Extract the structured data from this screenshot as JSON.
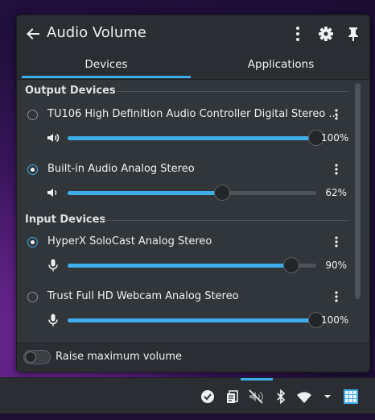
{
  "header": {
    "title": "Audio Volume"
  },
  "tabs": [
    {
      "label": "Devices",
      "active": true
    },
    {
      "label": "Applications",
      "active": false
    }
  ],
  "output": {
    "heading": "Output Devices",
    "devices": [
      {
        "name": "TU106 High Definition Audio Controller Digital Stereo ...",
        "selected": false,
        "volume_label": "100%",
        "volume": 1.0,
        "icon": "speaker-icon"
      },
      {
        "name": "Built-in Audio Analog Stereo",
        "selected": true,
        "volume_label": "62%",
        "volume": 0.62,
        "icon": "speaker-icon"
      }
    ]
  },
  "input": {
    "heading": "Input Devices",
    "devices": [
      {
        "name": "HyperX SoloCast Analog Stereo",
        "selected": true,
        "volume_label": "90%",
        "volume": 0.9,
        "icon": "microphone-icon"
      },
      {
        "name": "Trust Full HD Webcam Analog Stereo",
        "selected": false,
        "volume_label": "100%",
        "volume": 1.0,
        "icon": "microphone-icon"
      }
    ]
  },
  "footer": {
    "raise_label": "Raise maximum volume",
    "raise_enabled": false
  },
  "tray": {
    "icons": [
      "check-circle-icon",
      "clipboard-icon",
      "volume-muted-icon",
      "bluetooth-icon",
      "wifi-icon",
      "chevron-down-icon",
      "app-grid-icon"
    ]
  },
  "colors": {
    "accent": "#3daee9",
    "background": "#31363b",
    "header": "#2a2e32"
  }
}
